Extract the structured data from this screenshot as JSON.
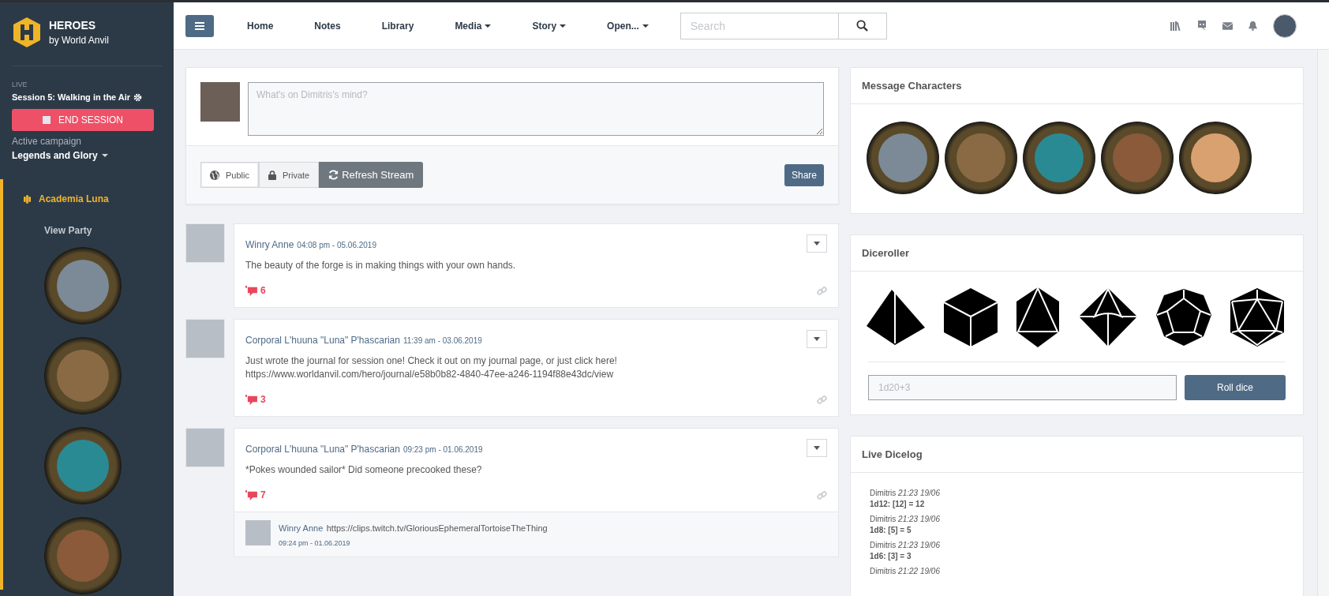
{
  "brand": {
    "name": "HEROES",
    "subtitle": "by World Anvil"
  },
  "session": {
    "status": "LIVE",
    "title": "Session 5: Walking in the Air",
    "end_button": "END SESSION"
  },
  "campaign": {
    "label": "Active campaign",
    "name": "Legends and Glory"
  },
  "group": {
    "label": "Academia Luna",
    "active": true,
    "party_link": "View Party"
  },
  "nav": {
    "items": [
      {
        "label": "Home",
        "dropdown": false
      },
      {
        "label": "Notes",
        "dropdown": false
      },
      {
        "label": "Library",
        "dropdown": false
      },
      {
        "label": "Media",
        "dropdown": true
      },
      {
        "label": "Story",
        "dropdown": true
      },
      {
        "label": "Open...",
        "dropdown": true
      }
    ]
  },
  "search": {
    "placeholder": "Search"
  },
  "composer": {
    "placeholder": "What's on Dimitris's mind?",
    "visibility": [
      {
        "kind": "public",
        "label": "Public",
        "selected": true
      },
      {
        "kind": "private",
        "label": "Private",
        "selected": false
      }
    ],
    "refresh": "Refresh Stream",
    "share": "Share"
  },
  "posts": [
    {
      "author": "Winry Anne",
      "time": "04:08 pm - 05.06.2019",
      "text": [
        "The beauty of the forge is in making things with your own hands."
      ],
      "comments": "6"
    },
    {
      "author": "Corporal L'huuna \"Luna\" P'hascarian",
      "time": "11:39 am - 03.06.2019",
      "text": [
        "Just wrote the journal for session one! Check it out on my journal page, or just click here!",
        "https://www.worldanvil.com/hero/journal/e58b0b82-4840-47ee-a246-1194f88e43dc/view"
      ],
      "comments": "3"
    },
    {
      "author": "Corporal L'huuna \"Luna\" P'hascarian",
      "time": "09:23 pm - 01.06.2019",
      "text": [
        "*Pokes wounded sailor* Did someone precooked these?"
      ],
      "comments": "7",
      "replies": [
        {
          "author": "Winry Anne",
          "text": "https://clips.twitch.tv/GloriousEphemeralTortoiseTheThing",
          "time": "09:24 pm - 01.06.2019"
        }
      ]
    }
  ],
  "message_characters": {
    "title": "Message Characters"
  },
  "diceroller": {
    "title": "Diceroller",
    "placeholder": "1d20+3",
    "roll_button": "Roll dice"
  },
  "dicelog": {
    "title": "Live Dicelog",
    "entries": [
      {
        "header": "Dimitris *21:23 19/06*",
        "result": "1d12: [12] = 12"
      },
      {
        "header": "Dimitris *21:23 19/06*",
        "result": "1d8: [5] = 5"
      },
      {
        "header": "Dimitris *21:23 19/06*",
        "result": "1d6: [3] = 3"
      },
      {
        "header": "Dimitris *21:22 19/06*"
      }
    ]
  }
}
